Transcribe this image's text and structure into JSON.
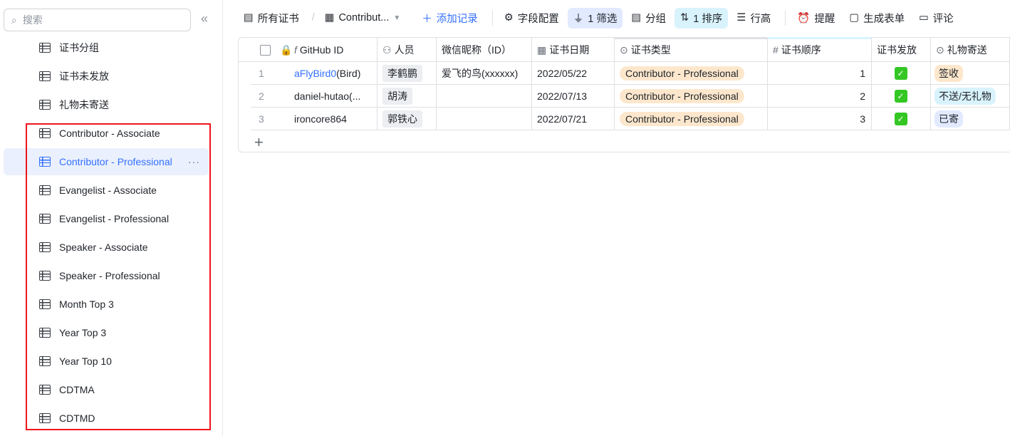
{
  "sidebar": {
    "search_placeholder": "搜索",
    "items": [
      {
        "label": "证书分组"
      },
      {
        "label": "证书未发放"
      },
      {
        "label": "礼物未寄送"
      },
      {
        "label": "Contributor - Associate"
      },
      {
        "label": "Contributor - Professional"
      },
      {
        "label": "Evangelist - Associate"
      },
      {
        "label": "Evangelist - Professional"
      },
      {
        "label": "Speaker - Associate"
      },
      {
        "label": "Speaker - Professional"
      },
      {
        "label": "Month Top 3"
      },
      {
        "label": "Year Top 3"
      },
      {
        "label": "Year Top 10"
      },
      {
        "label": "CDTMA"
      },
      {
        "label": "CDTMD"
      }
    ],
    "more": "···"
  },
  "toolbar": {
    "all": "所有证书",
    "view": "Contribut...",
    "add": "添加记录",
    "fields": "字段配置",
    "filter": "1 筛选",
    "group": "分组",
    "sort": "1 排序",
    "row_height": "行高",
    "remind": "提醒",
    "form": "生成表单",
    "comment": "评论"
  },
  "table": {
    "columns": [
      "GitHub ID",
      "人员",
      "微信昵称（ID）",
      "证书日期",
      "证书类型",
      "证书顺序",
      "证书发放",
      "礼物寄送"
    ],
    "rows": [
      {
        "n": "1",
        "gh_link": "aFlyBird0",
        "gh_rest": "(Bird)",
        "person": "李鹤鹏",
        "wechat": "爱飞的鸟(xxxxxx)",
        "date": "2022/05/22",
        "type": "Contributor - Professional",
        "order": "1",
        "gift": "签收"
      },
      {
        "n": "2",
        "gh_link": "",
        "gh_rest": "daniel-hutao(...",
        "person": "胡涛",
        "wechat": "",
        "date": "2022/07/13",
        "type": "Contributor - Professional",
        "order": "2",
        "gift": "不送/无礼物"
      },
      {
        "n": "3",
        "gh_link": "",
        "gh_rest": "ironcore864",
        "person": "郭铁心",
        "wechat": "",
        "date": "2022/07/21",
        "type": "Contributor - Professional",
        "order": "3",
        "gift": "已寄"
      }
    ],
    "add_row": "+"
  },
  "colors": {
    "accent": "#3370ff",
    "type_tag": "#fde7cc",
    "gift_signed": "#fde7cc",
    "gift_none": "#d9f3fd",
    "gift_sent": "#e1eaff",
    "check": "#34c724"
  }
}
